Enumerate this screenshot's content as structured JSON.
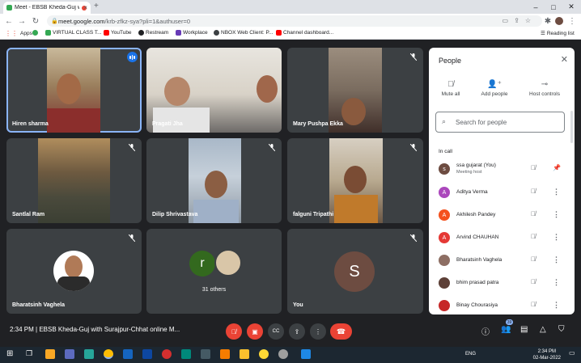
{
  "browser": {
    "tab_title": "Meet - EBSB Kheda-Guj with...",
    "url_host": "meet.google.com",
    "url_path": "/krb-zfkz-sya?pli=1&authuser=0",
    "bookmarks": [
      {
        "label": "Apps",
        "color": "#ea4335"
      },
      {
        "label": "",
        "color": "#34a853"
      },
      {
        "label": "VIRTUAL CLASS T...",
        "color": "#34a853"
      },
      {
        "label": "YouTube",
        "color": "#ff0000"
      },
      {
        "label": "Restream",
        "color": "#202124"
      },
      {
        "label": "Workplace",
        "color": "#673ab7"
      },
      {
        "label": "NBOX Web Client: P...",
        "color": "#3c4043"
      },
      {
        "label": "Channel dashboard...",
        "color": "#ff0000"
      }
    ],
    "reading_list": "Reading list"
  },
  "tiles": [
    {
      "name": "Hiren sharma",
      "speaking": true
    },
    {
      "name": "Pragati Jha",
      "speaking": false
    },
    {
      "name": "Mary Pushpa Ekka",
      "speaking": false
    },
    {
      "name": "Santlal Ram",
      "speaking": false
    },
    {
      "name": "Dilip Shrivastava",
      "speaking": false
    },
    {
      "name": "falguni Tripathi",
      "speaking": false
    },
    {
      "name": "Bharatsinh Vaghela",
      "speaking": false
    },
    {
      "name": "31 others",
      "speaking": false,
      "initial": "r"
    },
    {
      "name": "You",
      "speaking": false,
      "initial": "S"
    }
  ],
  "people": {
    "title": "People",
    "actions": [
      "Mute all",
      "Add people",
      "Host controls"
    ],
    "search_placeholder": "Search for people",
    "section": "In call",
    "participants": [
      {
        "name": "ssa gujarat (You)",
        "sub": "Meeting host",
        "initial": "s",
        "color": "#6d4c41"
      },
      {
        "name": "Aditya Verma",
        "sub": "",
        "initial": "A",
        "color": "#ab47bc"
      },
      {
        "name": "Akhilesh Pandey",
        "sub": "",
        "initial": "A",
        "color": "#f4511e"
      },
      {
        "name": "Arvind CHAUHAN",
        "sub": "",
        "initial": "A",
        "color": "#e53935"
      },
      {
        "name": "Bharatsinh Vaghela",
        "sub": "",
        "initial": "",
        "color": "#8d6e63"
      },
      {
        "name": "bhim prasad patra",
        "sub": "",
        "initial": "",
        "color": "#5d4037"
      },
      {
        "name": "Binay Chourasiya",
        "sub": "",
        "initial": "",
        "color": "#c62828"
      }
    ]
  },
  "bottombar": {
    "meeting_text": "2:34 PM  |  EBSB Kheda-Guj with Surajpur-Chhat online M...",
    "people_count": "39"
  },
  "taskbar": {
    "lang": "ENG",
    "time": "2:34 PM",
    "date": "02-Mar-2022"
  }
}
